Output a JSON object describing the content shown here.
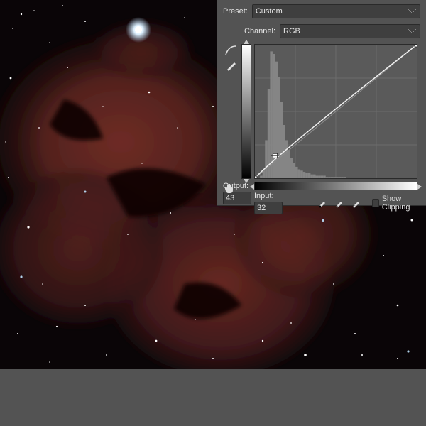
{
  "panel": {
    "preset_label": "Preset:",
    "preset_value": "Custom",
    "channel_label": "Channel:",
    "channel_value": "RGB",
    "output_label": "Output:",
    "output_value": "43",
    "input_label": "Input:",
    "input_value": "32",
    "show_clipping_label": "Show Clipping",
    "show_clipping_checked": false
  },
  "chart_data": {
    "type": "line",
    "title": "",
    "xlabel": "Input",
    "ylabel": "Output",
    "xlim": [
      0,
      255
    ],
    "ylim": [
      0,
      255
    ],
    "series": [
      {
        "name": "curve",
        "points": [
          {
            "x": 0,
            "y": 0
          },
          {
            "x": 32,
            "y": 43
          },
          {
            "x": 255,
            "y": 255
          }
        ]
      },
      {
        "name": "baseline",
        "points": [
          {
            "x": 0,
            "y": 0
          },
          {
            "x": 255,
            "y": 255
          }
        ]
      }
    ],
    "histogram": {
      "note": "approximate luminance histogram of image",
      "bins": [
        0,
        0,
        2,
        6,
        30,
        70,
        100,
        98,
        92,
        80,
        60,
        42,
        30,
        22,
        16,
        12,
        9,
        7,
        6,
        5,
        4,
        4,
        3,
        3,
        2,
        2,
        2,
        2,
        1,
        1,
        1,
        1,
        1,
        1,
        1,
        1,
        0,
        0,
        0,
        0,
        0,
        0,
        0,
        0,
        0,
        0,
        0,
        0,
        0,
        0,
        0,
        0,
        0,
        0,
        0,
        0,
        0,
        0,
        0,
        0,
        0,
        0,
        0,
        0
      ]
    },
    "selected_point": {
      "x": 32,
      "y": 43
    }
  },
  "icons": {
    "curve_tool": "curve-tool-icon",
    "pencil_tool": "pencil-icon",
    "hand_sampler": "hand-sampler-icon",
    "eyedropper_black": "eyedropper-black-icon",
    "eyedropper_gray": "eyedropper-gray-icon",
    "eyedropper_white": "eyedropper-white-icon"
  },
  "colors": {
    "panel_bg": "#535353",
    "field_bg": "#3f3f3f",
    "border": "#2a2a2a",
    "text": "#e6e6e6",
    "nebula_red": "#6b2a25",
    "nebula_dark": "#1a0a0a",
    "star_white": "#ffffff",
    "star_cyan": "#cde8ff"
  },
  "image": {
    "description": "Deep-sky astrophotography: reddish emission nebula with dark dust lanes against a dense starfield"
  }
}
